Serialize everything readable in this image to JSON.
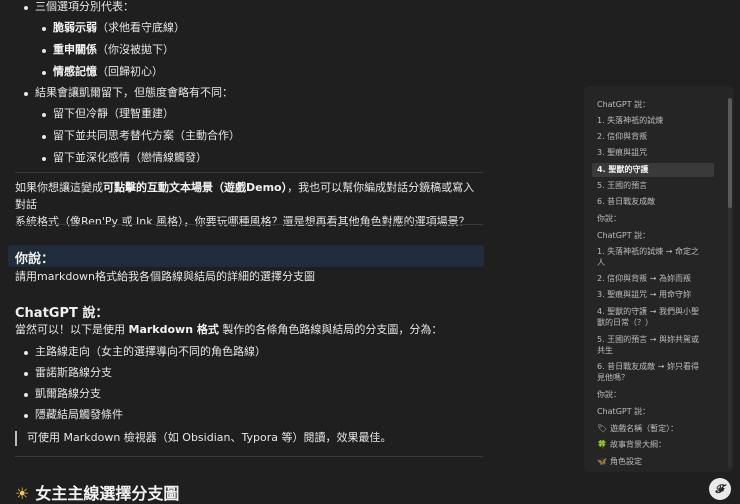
{
  "top_list": {
    "partial_item": "三個選項分別代表：",
    "sub_items": [
      {
        "bold": "脆弱示弱",
        "rest": "（求他看守底線）"
      },
      {
        "bold": "重申關係",
        "rest": "（你沒被拋下）"
      },
      {
        "bold": "情感記憶",
        "rest": "（回歸初心）"
      }
    ],
    "second_item": "結果會讓凱爾留下，但態度會略有不同：",
    "second_sub_items": [
      "留下但冷靜（理智重建）",
      "留下並共同思考替代方案（主動合作）",
      "留下並深化感情（戀情線觸發）"
    ]
  },
  "paragraph": {
    "pre": "如果你想讓這變成",
    "bold": "可點擊的互動文本場景（遊戲Demo）",
    "post_line1": "，我也可以幫你編成對話分鏡稿或寫入對話",
    "line2": "系統格式（像Ren'Py 或 Ink 風格），你要玩哪種風格？還是想再看其他角色對應的選項場景？"
  },
  "you_said": {
    "label": "你說：",
    "message": "請用markdown格式給我各個路線與結局的詳細的選擇分支圖"
  },
  "chatgpt": {
    "label": "ChatGPT 說：",
    "intro_pre": "當然可以！以下是使用 ",
    "intro_bold": "Markdown 格式",
    "intro_post": " 製作的各條角色路線與結局的分支圖，分為：",
    "bullets": [
      "主路線走向（女主的選擇導向不同的角色路線）",
      "雷諾斯路線分支",
      "凱爾路線分支",
      "隱藏結局觸發條件"
    ],
    "quote": "可使用 Markdown 檢視器（如 Obsidian、Typora 等）閱讀，效果最佳。",
    "heading": "女主主線選擇分支圖"
  },
  "sidebar": {
    "items": [
      {
        "text": "ChatGPT 說：",
        "type": "head"
      },
      {
        "text": "1. 失落神祇的試煉",
        "type": "item"
      },
      {
        "text": "2. 信仰與背叛",
        "type": "item"
      },
      {
        "text": "3. 聖痕與詛咒",
        "type": "item"
      },
      {
        "text": "4. 聖獸的守護",
        "type": "active"
      },
      {
        "text": "5. 王國的預言",
        "type": "item"
      },
      {
        "text": "6. 昔日戰友成敵",
        "type": "item"
      },
      {
        "text": "你說：",
        "type": "head"
      },
      {
        "text": "ChatGPT 說：",
        "type": "head"
      },
      {
        "text": "1. 失落神祇的試煉 → 命定之",
        "type": "item"
      },
      {
        "text": "人",
        "type": "cont"
      },
      {
        "text": "2. 信仰與背叛 → 為妳而叛",
        "type": "item"
      },
      {
        "text": "3. 聖痕與詛咒 → 用命守妳",
        "type": "item"
      },
      {
        "text": "4. 聖獸的守護 → 我們與小聖",
        "type": "item"
      },
      {
        "text": "獸的日常（？）",
        "type": "cont"
      },
      {
        "text": "5. 王國的預言 → 與妳共駕或",
        "type": "item"
      },
      {
        "text": "共生",
        "type": "cont"
      },
      {
        "text": "6. 昔日戰友成敵 → 妳只看得",
        "type": "item"
      },
      {
        "text": "見他嗎？",
        "type": "cont"
      },
      {
        "text": "你說：",
        "type": "head"
      },
      {
        "text": "ChatGPT 說：",
        "type": "head"
      },
      {
        "text": "遊戲名稱（暫定）：",
        "type": "item",
        "icon": "🏷"
      },
      {
        "text": "故事背景大綱：",
        "type": "item",
        "icon": "🍀"
      },
      {
        "text": "角色設定",
        "type": "item",
        "icon": "🦋"
      }
    ]
  },
  "badge_text": "𝓕"
}
